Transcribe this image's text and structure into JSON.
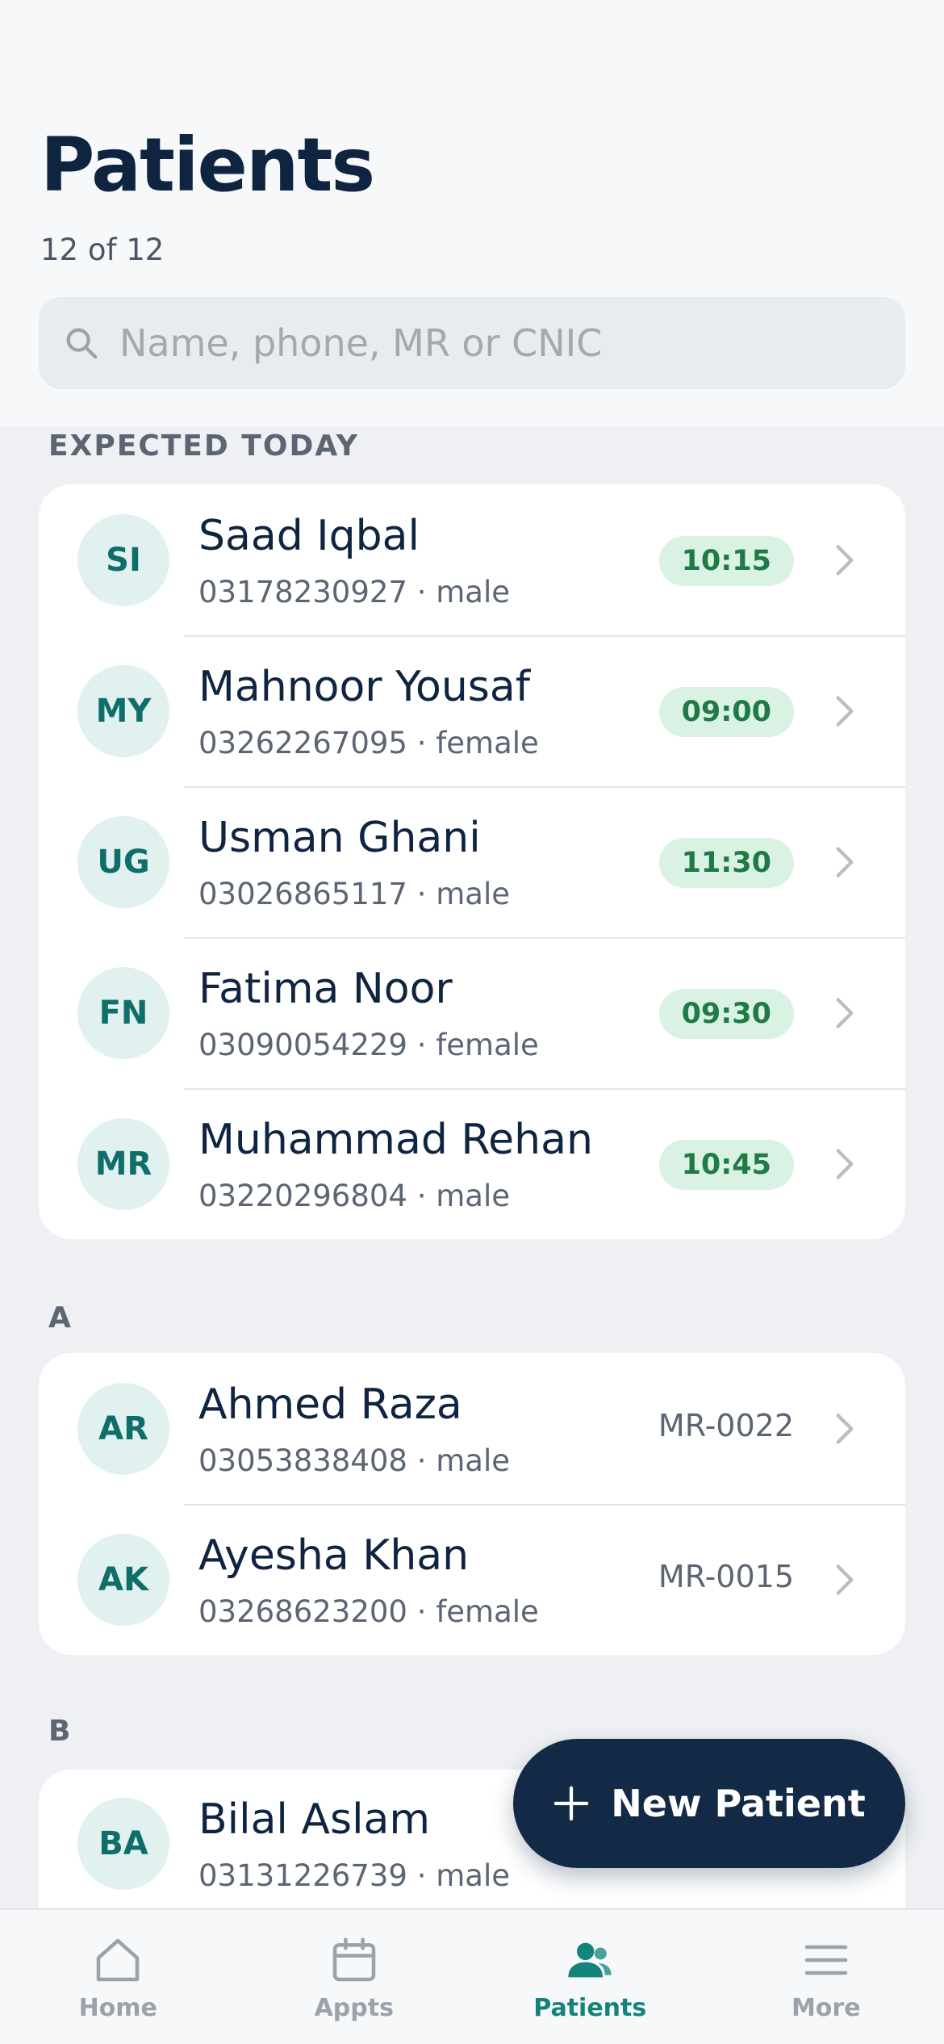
{
  "header": {
    "title": "Patients",
    "count": "12 of 12",
    "search_placeholder": "Name, phone, MR or CNIC"
  },
  "sections": {
    "expected_today": {
      "label": "EXPECTED TODAY",
      "rows": [
        {
          "initials": "SI",
          "name": "Saad Iqbal",
          "phone": "03178230927",
          "gender": "male",
          "time": "10:15"
        },
        {
          "initials": "MY",
          "name": "Mahnoor Yousaf",
          "phone": "03262267095",
          "gender": "female",
          "time": "09:00"
        },
        {
          "initials": "UG",
          "name": "Usman Ghani",
          "phone": "03026865117",
          "gender": "male",
          "time": "11:30"
        },
        {
          "initials": "FN",
          "name": "Fatima Noor",
          "phone": "03090054229",
          "gender": "female",
          "time": "09:30"
        },
        {
          "initials": "MR",
          "name": "Muhammad Rehan",
          "phone": "03220296804",
          "gender": "male",
          "time": "10:45"
        }
      ]
    },
    "a": {
      "label": "A",
      "rows": [
        {
          "initials": "AR",
          "name": "Ahmed Raza",
          "phone": "03053838408",
          "gender": "male",
          "mr": "MR-0022"
        },
        {
          "initials": "AK",
          "name": "Ayesha Khan",
          "phone": "03268623200",
          "gender": "female",
          "mr": "MR-0015"
        }
      ]
    },
    "b": {
      "label": "B",
      "rows": [
        {
          "initials": "BA",
          "name": "Bilal Aslam",
          "phone": "03131226739",
          "gender": "male"
        }
      ]
    }
  },
  "fab": {
    "label": "New Patient",
    "icon": "plus-icon"
  },
  "tabbar": {
    "active": "patients",
    "tabs": [
      {
        "id": "home",
        "label": "Home",
        "icon": "home-icon"
      },
      {
        "id": "appts",
        "label": "Appts",
        "icon": "calendar-icon"
      },
      {
        "id": "patients",
        "label": "Patients",
        "icon": "people-icon"
      },
      {
        "id": "more",
        "label": "More",
        "icon": "menu-icon"
      }
    ]
  },
  "colors": {
    "primary_dark": "#0f2440",
    "accent_teal": "#13837b",
    "badge_green_bg": "#d9f2e3",
    "badge_green_text": "#1f7a45",
    "avatar_bg": "#e0f1ef",
    "avatar_text": "#0f6e6a",
    "fab_bg": "#132a47"
  }
}
